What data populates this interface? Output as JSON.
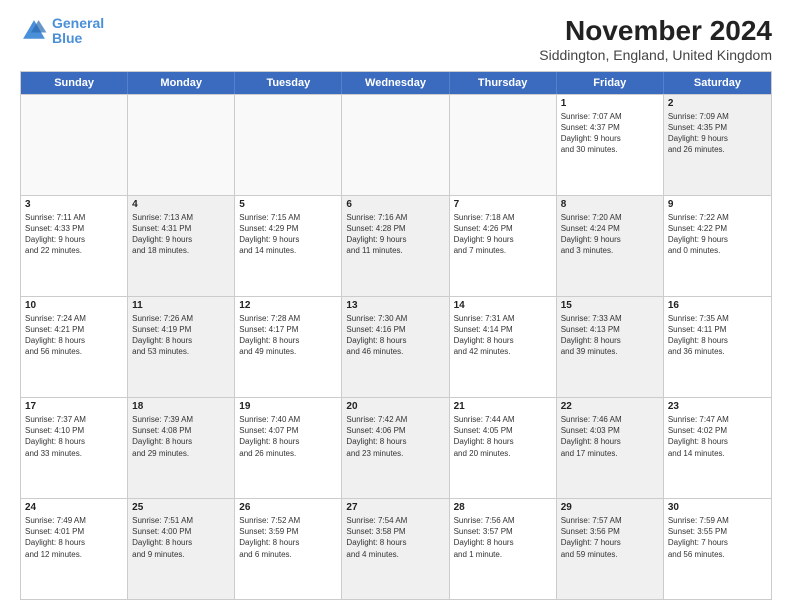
{
  "logo": {
    "line1": "General",
    "line2": "Blue"
  },
  "title": "November 2024",
  "subtitle": "Siddington, England, United Kingdom",
  "days": [
    "Sunday",
    "Monday",
    "Tuesday",
    "Wednesday",
    "Thursday",
    "Friday",
    "Saturday"
  ],
  "rows": [
    [
      {
        "day": "",
        "info": "",
        "shaded": false,
        "empty": true
      },
      {
        "day": "",
        "info": "",
        "shaded": false,
        "empty": true
      },
      {
        "day": "",
        "info": "",
        "shaded": false,
        "empty": true
      },
      {
        "day": "",
        "info": "",
        "shaded": false,
        "empty": true
      },
      {
        "day": "",
        "info": "",
        "shaded": false,
        "empty": true
      },
      {
        "day": "1",
        "info": "Sunrise: 7:07 AM\nSunset: 4:37 PM\nDaylight: 9 hours\nand 30 minutes.",
        "shaded": false,
        "empty": false
      },
      {
        "day": "2",
        "info": "Sunrise: 7:09 AM\nSunset: 4:35 PM\nDaylight: 9 hours\nand 26 minutes.",
        "shaded": true,
        "empty": false
      }
    ],
    [
      {
        "day": "3",
        "info": "Sunrise: 7:11 AM\nSunset: 4:33 PM\nDaylight: 9 hours\nand 22 minutes.",
        "shaded": false,
        "empty": false
      },
      {
        "day": "4",
        "info": "Sunrise: 7:13 AM\nSunset: 4:31 PM\nDaylight: 9 hours\nand 18 minutes.",
        "shaded": true,
        "empty": false
      },
      {
        "day": "5",
        "info": "Sunrise: 7:15 AM\nSunset: 4:29 PM\nDaylight: 9 hours\nand 14 minutes.",
        "shaded": false,
        "empty": false
      },
      {
        "day": "6",
        "info": "Sunrise: 7:16 AM\nSunset: 4:28 PM\nDaylight: 9 hours\nand 11 minutes.",
        "shaded": true,
        "empty": false
      },
      {
        "day": "7",
        "info": "Sunrise: 7:18 AM\nSunset: 4:26 PM\nDaylight: 9 hours\nand 7 minutes.",
        "shaded": false,
        "empty": false
      },
      {
        "day": "8",
        "info": "Sunrise: 7:20 AM\nSunset: 4:24 PM\nDaylight: 9 hours\nand 3 minutes.",
        "shaded": true,
        "empty": false
      },
      {
        "day": "9",
        "info": "Sunrise: 7:22 AM\nSunset: 4:22 PM\nDaylight: 9 hours\nand 0 minutes.",
        "shaded": false,
        "empty": false
      }
    ],
    [
      {
        "day": "10",
        "info": "Sunrise: 7:24 AM\nSunset: 4:21 PM\nDaylight: 8 hours\nand 56 minutes.",
        "shaded": false,
        "empty": false
      },
      {
        "day": "11",
        "info": "Sunrise: 7:26 AM\nSunset: 4:19 PM\nDaylight: 8 hours\nand 53 minutes.",
        "shaded": true,
        "empty": false
      },
      {
        "day": "12",
        "info": "Sunrise: 7:28 AM\nSunset: 4:17 PM\nDaylight: 8 hours\nand 49 minutes.",
        "shaded": false,
        "empty": false
      },
      {
        "day": "13",
        "info": "Sunrise: 7:30 AM\nSunset: 4:16 PM\nDaylight: 8 hours\nand 46 minutes.",
        "shaded": true,
        "empty": false
      },
      {
        "day": "14",
        "info": "Sunrise: 7:31 AM\nSunset: 4:14 PM\nDaylight: 8 hours\nand 42 minutes.",
        "shaded": false,
        "empty": false
      },
      {
        "day": "15",
        "info": "Sunrise: 7:33 AM\nSunset: 4:13 PM\nDaylight: 8 hours\nand 39 minutes.",
        "shaded": true,
        "empty": false
      },
      {
        "day": "16",
        "info": "Sunrise: 7:35 AM\nSunset: 4:11 PM\nDaylight: 8 hours\nand 36 minutes.",
        "shaded": false,
        "empty": false
      }
    ],
    [
      {
        "day": "17",
        "info": "Sunrise: 7:37 AM\nSunset: 4:10 PM\nDaylight: 8 hours\nand 33 minutes.",
        "shaded": false,
        "empty": false
      },
      {
        "day": "18",
        "info": "Sunrise: 7:39 AM\nSunset: 4:08 PM\nDaylight: 8 hours\nand 29 minutes.",
        "shaded": true,
        "empty": false
      },
      {
        "day": "19",
        "info": "Sunrise: 7:40 AM\nSunset: 4:07 PM\nDaylight: 8 hours\nand 26 minutes.",
        "shaded": false,
        "empty": false
      },
      {
        "day": "20",
        "info": "Sunrise: 7:42 AM\nSunset: 4:06 PM\nDaylight: 8 hours\nand 23 minutes.",
        "shaded": true,
        "empty": false
      },
      {
        "day": "21",
        "info": "Sunrise: 7:44 AM\nSunset: 4:05 PM\nDaylight: 8 hours\nand 20 minutes.",
        "shaded": false,
        "empty": false
      },
      {
        "day": "22",
        "info": "Sunrise: 7:46 AM\nSunset: 4:03 PM\nDaylight: 8 hours\nand 17 minutes.",
        "shaded": true,
        "empty": false
      },
      {
        "day": "23",
        "info": "Sunrise: 7:47 AM\nSunset: 4:02 PM\nDaylight: 8 hours\nand 14 minutes.",
        "shaded": false,
        "empty": false
      }
    ],
    [
      {
        "day": "24",
        "info": "Sunrise: 7:49 AM\nSunset: 4:01 PM\nDaylight: 8 hours\nand 12 minutes.",
        "shaded": false,
        "empty": false
      },
      {
        "day": "25",
        "info": "Sunrise: 7:51 AM\nSunset: 4:00 PM\nDaylight: 8 hours\nand 9 minutes.",
        "shaded": true,
        "empty": false
      },
      {
        "day": "26",
        "info": "Sunrise: 7:52 AM\nSunset: 3:59 PM\nDaylight: 8 hours\nand 6 minutes.",
        "shaded": false,
        "empty": false
      },
      {
        "day": "27",
        "info": "Sunrise: 7:54 AM\nSunset: 3:58 PM\nDaylight: 8 hours\nand 4 minutes.",
        "shaded": true,
        "empty": false
      },
      {
        "day": "28",
        "info": "Sunrise: 7:56 AM\nSunset: 3:57 PM\nDaylight: 8 hours\nand 1 minute.",
        "shaded": false,
        "empty": false
      },
      {
        "day": "29",
        "info": "Sunrise: 7:57 AM\nSunset: 3:56 PM\nDaylight: 7 hours\nand 59 minutes.",
        "shaded": true,
        "empty": false
      },
      {
        "day": "30",
        "info": "Sunrise: 7:59 AM\nSunset: 3:55 PM\nDaylight: 7 hours\nand 56 minutes.",
        "shaded": false,
        "empty": false
      }
    ]
  ]
}
